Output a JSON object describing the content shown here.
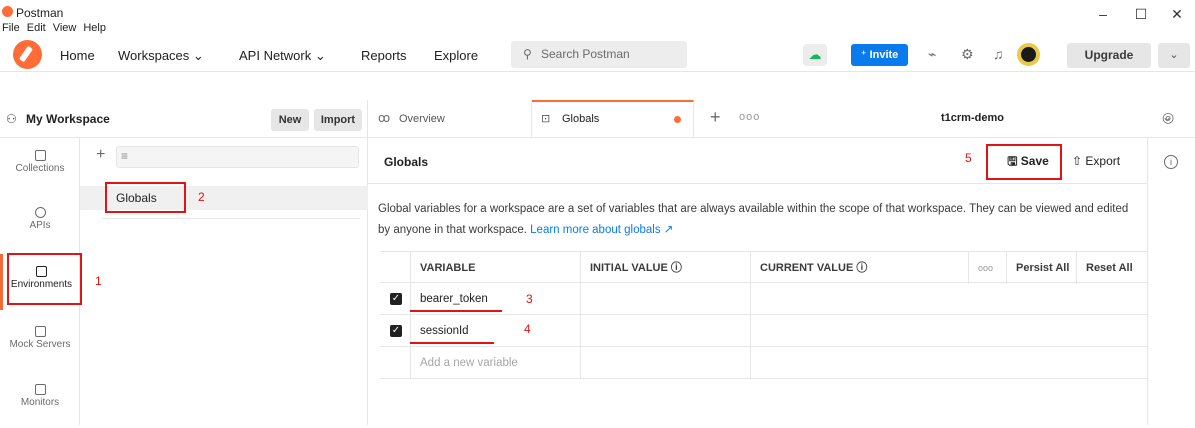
{
  "window": {
    "app_title": "Postman",
    "minimize": "–",
    "maximize": "☐",
    "close": "✕"
  },
  "menu": [
    "File",
    "Edit",
    "View",
    "Help"
  ],
  "header": {
    "nav": [
      {
        "label": "Home"
      },
      {
        "label": "Workspaces ⌄"
      },
      {
        "label": "API Network ⌄"
      },
      {
        "label": "Reports"
      },
      {
        "label": "Explore"
      }
    ],
    "search_placeholder": "Search Postman",
    "invite_label": "⁺ Invite",
    "upgrade_label": "Upgrade"
  },
  "workspace": {
    "name": "My Workspace",
    "new_label": "New",
    "import_label": "Import"
  },
  "rail": [
    {
      "label": "Collections"
    },
    {
      "label": "APIs"
    },
    {
      "label": "Environments"
    },
    {
      "label": "Mock Servers"
    },
    {
      "label": "Monitors"
    }
  ],
  "left_panel": {
    "globals_label": "Globals"
  },
  "tabs": {
    "overview_label": "Overview",
    "globals_label": "Globals",
    "environment_selected": "t1crm-demo"
  },
  "content": {
    "title": "Globals",
    "save_label": "Save",
    "export_label": "Export",
    "description": "Global variables for a workspace are a set of variables that are always available within the scope of that workspace. They can be viewed and edited by anyone in that workspace.",
    "learn_more": "Learn more about globals ↗"
  },
  "table": {
    "headers": {
      "variable": "VARIABLE",
      "initial": "INITIAL VALUE ⓘ",
      "current": "CURRENT VALUE ⓘ",
      "more": "ooo",
      "persist_all": "Persist All",
      "reset_all": "Reset All"
    },
    "rows": [
      {
        "variable": "bearer_token",
        "initial": "",
        "current": "",
        "checked": true
      },
      {
        "variable": "sessionId",
        "initial": "",
        "current": "",
        "checked": true
      }
    ],
    "add_placeholder": "Add a new variable"
  },
  "annotations": {
    "a1": "1",
    "a2": "2",
    "a3": "3",
    "a4": "4",
    "a5": "5"
  },
  "colors": {
    "brand": "#ff6c37",
    "invite": "#097bed",
    "annotation": "#e01414"
  }
}
